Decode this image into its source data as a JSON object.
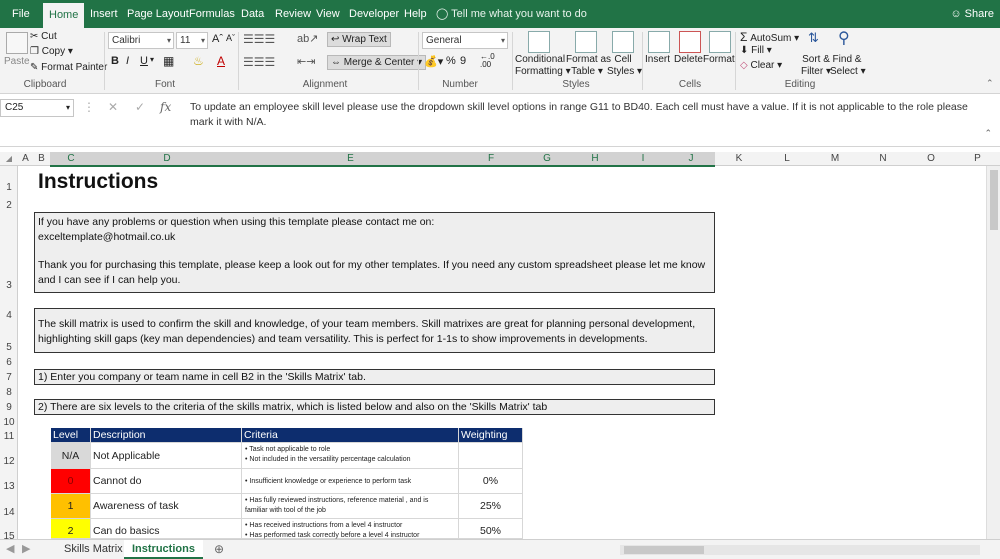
{
  "ribbon_tabs": [
    "File",
    "Home",
    "Insert",
    "Page Layout",
    "Formulas",
    "Data",
    "Review",
    "View",
    "Developer",
    "Help"
  ],
  "tell_me": "Tell me what you want to do",
  "share": "Share",
  "clipboard": {
    "paste": "Paste",
    "cut": "Cut",
    "copy": "Copy",
    "format_painter": "Format Painter",
    "label": "Clipboard"
  },
  "font": {
    "name": "Calibri",
    "size": "11",
    "label": "Font"
  },
  "alignment": {
    "wrap": "Wrap Text",
    "merge": "Merge & Center",
    "label": "Alignment"
  },
  "number": {
    "format": "General",
    "percent": "%",
    "comma": "9",
    "label": "Number"
  },
  "styles": {
    "conditional": "Conditional",
    "conditional2": "Formatting",
    "format_as": "Format as",
    "table": "Table",
    "cell": "Cell",
    "styles2": "Styles",
    "label": "Styles"
  },
  "cells": {
    "insert": "Insert",
    "delete": "Delete",
    "format": "Format",
    "label": "Cells"
  },
  "editing": {
    "autosum": "AutoSum",
    "fill": "Fill",
    "clear": "Clear",
    "sort": "Sort &",
    "filter": "Filter",
    "find": "Find &",
    "select": "Select",
    "label": "Editing"
  },
  "formula_bar": {
    "name_box": "C25",
    "fx": "fx",
    "content": "To update an employee skill level please use the dropdown skill level options in range G11 to BD40. Each cell must have a value. If it is not applicable to the role please mark it with N/A."
  },
  "columns": [
    "A",
    "B",
    "C",
    "D",
    "E",
    "F",
    "G",
    "H",
    "I",
    "J",
    "K",
    "L",
    "M",
    "N",
    "O",
    "P"
  ],
  "rows": [
    "1",
    "2",
    "3",
    "4",
    "5",
    "6",
    "7",
    "8",
    "9",
    "10",
    "11",
    "12",
    "13",
    "14",
    "15"
  ],
  "sheet": {
    "title": "Instructions",
    "box1_line1": "If you have any problems or question when using this template please contact me on:",
    "box1_line2": "exceltemplate@hotmail.co.uk",
    "box1_line3": "Thank you for purchasing this template, please keep a look out for my other templates. If you need any custom spreadsheet please let me know and I can see if I can help you.",
    "box2": "The skill matrix is used to confirm the skill and knowledge, of your team members. Skill matrixes are great for planning personal development, highlighting skill gaps (key man dependencies) and team versatility. This is perfect for 1-1s to show improvements in developments.",
    "step1": "1)  Enter you company or team name in cell B2 in the 'Skills Matrix' tab.",
    "step2": "2)  There are six levels to the criteria of the skills matrix, which is listed below and also on the 'Skills Matrix' tab"
  },
  "table": {
    "headers": [
      "Level",
      "Description",
      "Criteria",
      "Weighting"
    ],
    "rows": [
      {
        "level": "N/A",
        "desc": "Not Applicable",
        "crit1": "• Task not applicable to role",
        "crit2": "• Not included in the versatility percentage calculation",
        "weight": "",
        "color": "#d9d9d9"
      },
      {
        "level": "0",
        "desc": "Cannot do",
        "crit1": "• Insufficient knowledge or experience to perform task",
        "crit2": "",
        "weight": "0%",
        "color": "#ff0000"
      },
      {
        "level": "1",
        "desc": "Awareness of task",
        "crit1": "• Has fully reviewed instructions, reference material , and is",
        "crit2": "familiar with tool of the job",
        "weight": "25%",
        "color": "#ffc000"
      },
      {
        "level": "2",
        "desc": "Can do basics",
        "crit1": "• Has received instructions from a level 4 instructor",
        "crit2": "• Has performed task correctly before a level 4 instructor",
        "weight": "50%",
        "color": "#ffff00"
      }
    ]
  },
  "sheet_tabs": [
    "Skills Matrix",
    "Instructions"
  ],
  "colors": {
    "excel_green": "#217346",
    "table_header": "#0d2d6e"
  }
}
